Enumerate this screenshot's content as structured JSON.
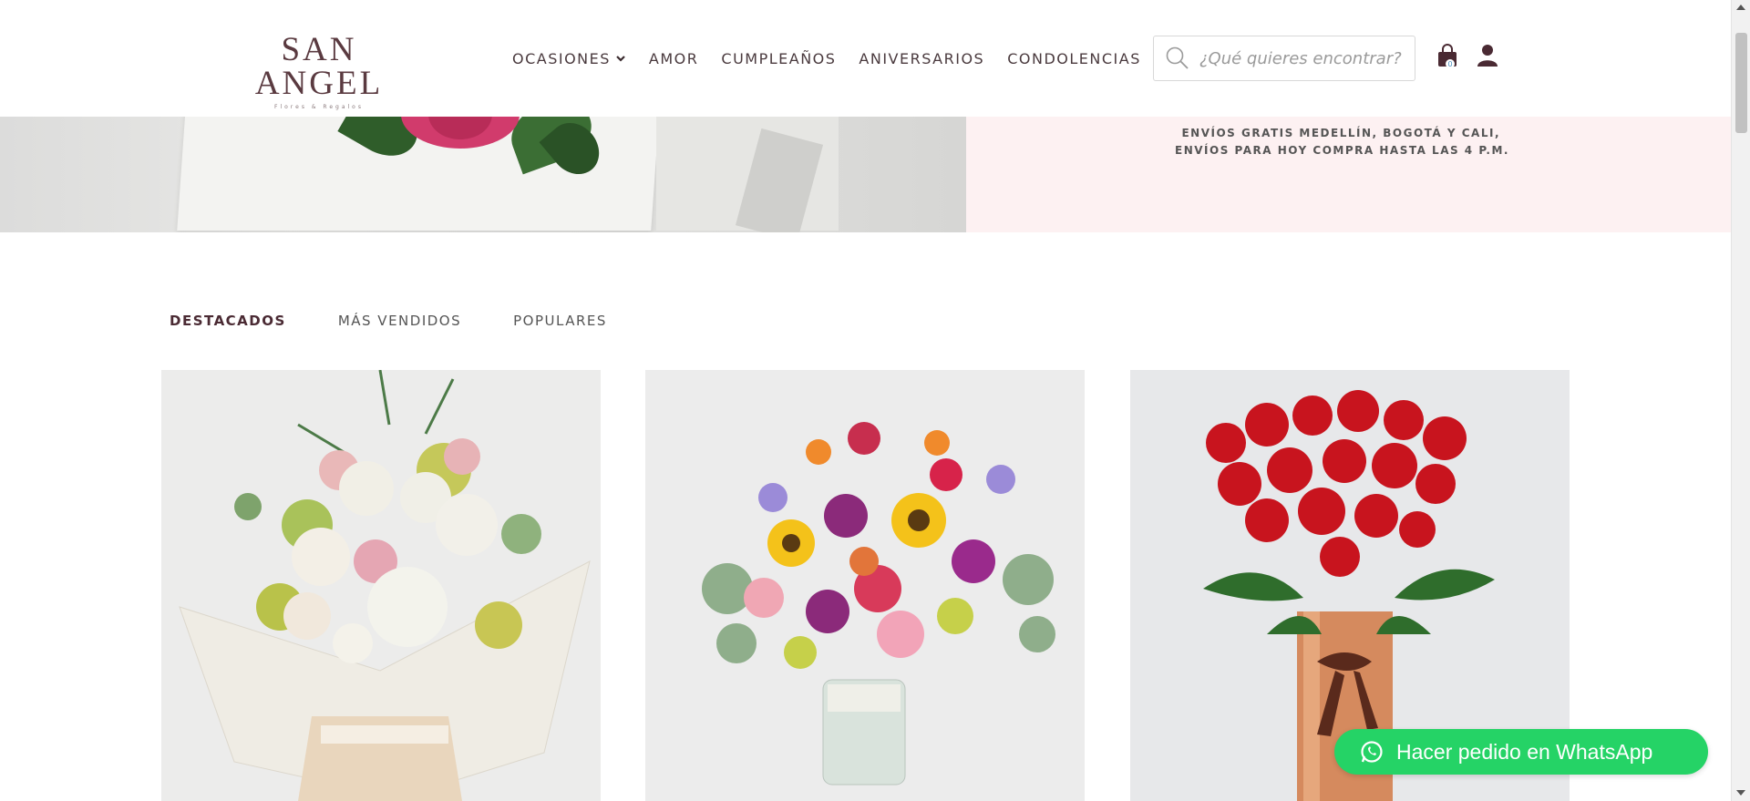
{
  "brand": {
    "name": "SAN ANGEL",
    "tagline": "Flores & Regalos"
  },
  "nav": {
    "items": [
      {
        "label": "OCASIONES",
        "has_dropdown": true
      },
      {
        "label": "AMOR"
      },
      {
        "label": "CUMPLEAÑOS"
      },
      {
        "label": "ANIVERSARIOS"
      },
      {
        "label": "CONDOLENCIAS"
      }
    ]
  },
  "search": {
    "placeholder": "¿Qué quieres encontrar?"
  },
  "cart": {
    "count": "0"
  },
  "hero": {
    "line1": "ENVÍOS GRATIS MEDELLÍN, BOGOTÁ Y CALI,",
    "line2": "ENVÍOS PARA HOY COMPRA HASTA LAS 4 P.M.",
    "background_color": "#fdf1f2"
  },
  "tabs": [
    {
      "label": "DESTACADOS",
      "active": true
    },
    {
      "label": "MÁS VENDIDOS",
      "active": false
    },
    {
      "label": "POPULARES",
      "active": false
    }
  ],
  "products": [
    {
      "image": "bouquet-white-pink-hydrangea"
    },
    {
      "image": "vase-sunflowers-mixed-flowers"
    },
    {
      "image": "vase-red-roses"
    }
  ],
  "whatsapp": {
    "label": "Hacer pedido en WhatsApp",
    "color": "#25d366"
  },
  "colors": {
    "brand": "#5a3a40",
    "text": "#4a3a3e"
  }
}
